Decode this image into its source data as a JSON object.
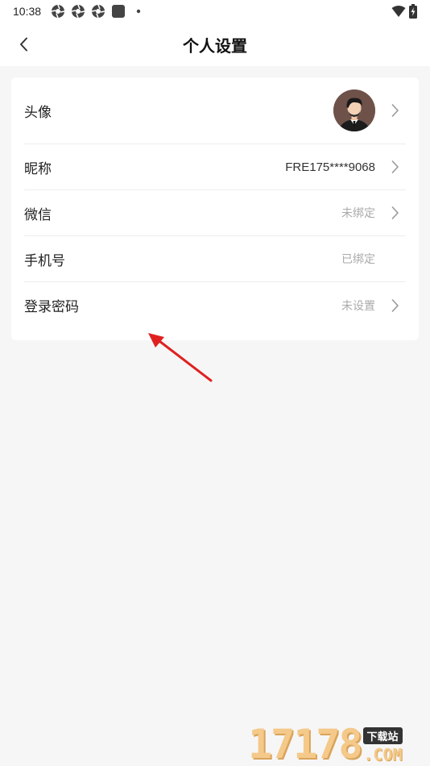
{
  "status_bar": {
    "time": "10:38",
    "notification_icons": [
      "aperture-icon",
      "aperture-icon",
      "aperture-icon",
      "square-app-icon",
      "dot-icon"
    ],
    "right_icons": [
      "wifi-icon",
      "battery-charging-icon"
    ]
  },
  "header": {
    "title": "个人设置",
    "back_icon": "chevron-left-icon"
  },
  "settings": {
    "avatar": {
      "label": "头像"
    },
    "nickname": {
      "label": "昵称",
      "value": "FRE175****9068"
    },
    "wechat": {
      "label": "微信",
      "value": "未绑定"
    },
    "phone": {
      "label": "手机号",
      "value": "已绑定"
    },
    "password": {
      "label": "登录密码",
      "value": "未设置"
    }
  },
  "watermark": {
    "number": "17178",
    "tag": "下载站",
    "suffix": ".COM"
  },
  "colors": {
    "background": "#f6f6f6",
    "card": "#ffffff",
    "muted_text": "#aaaaaa",
    "arrow": "#e02020"
  }
}
